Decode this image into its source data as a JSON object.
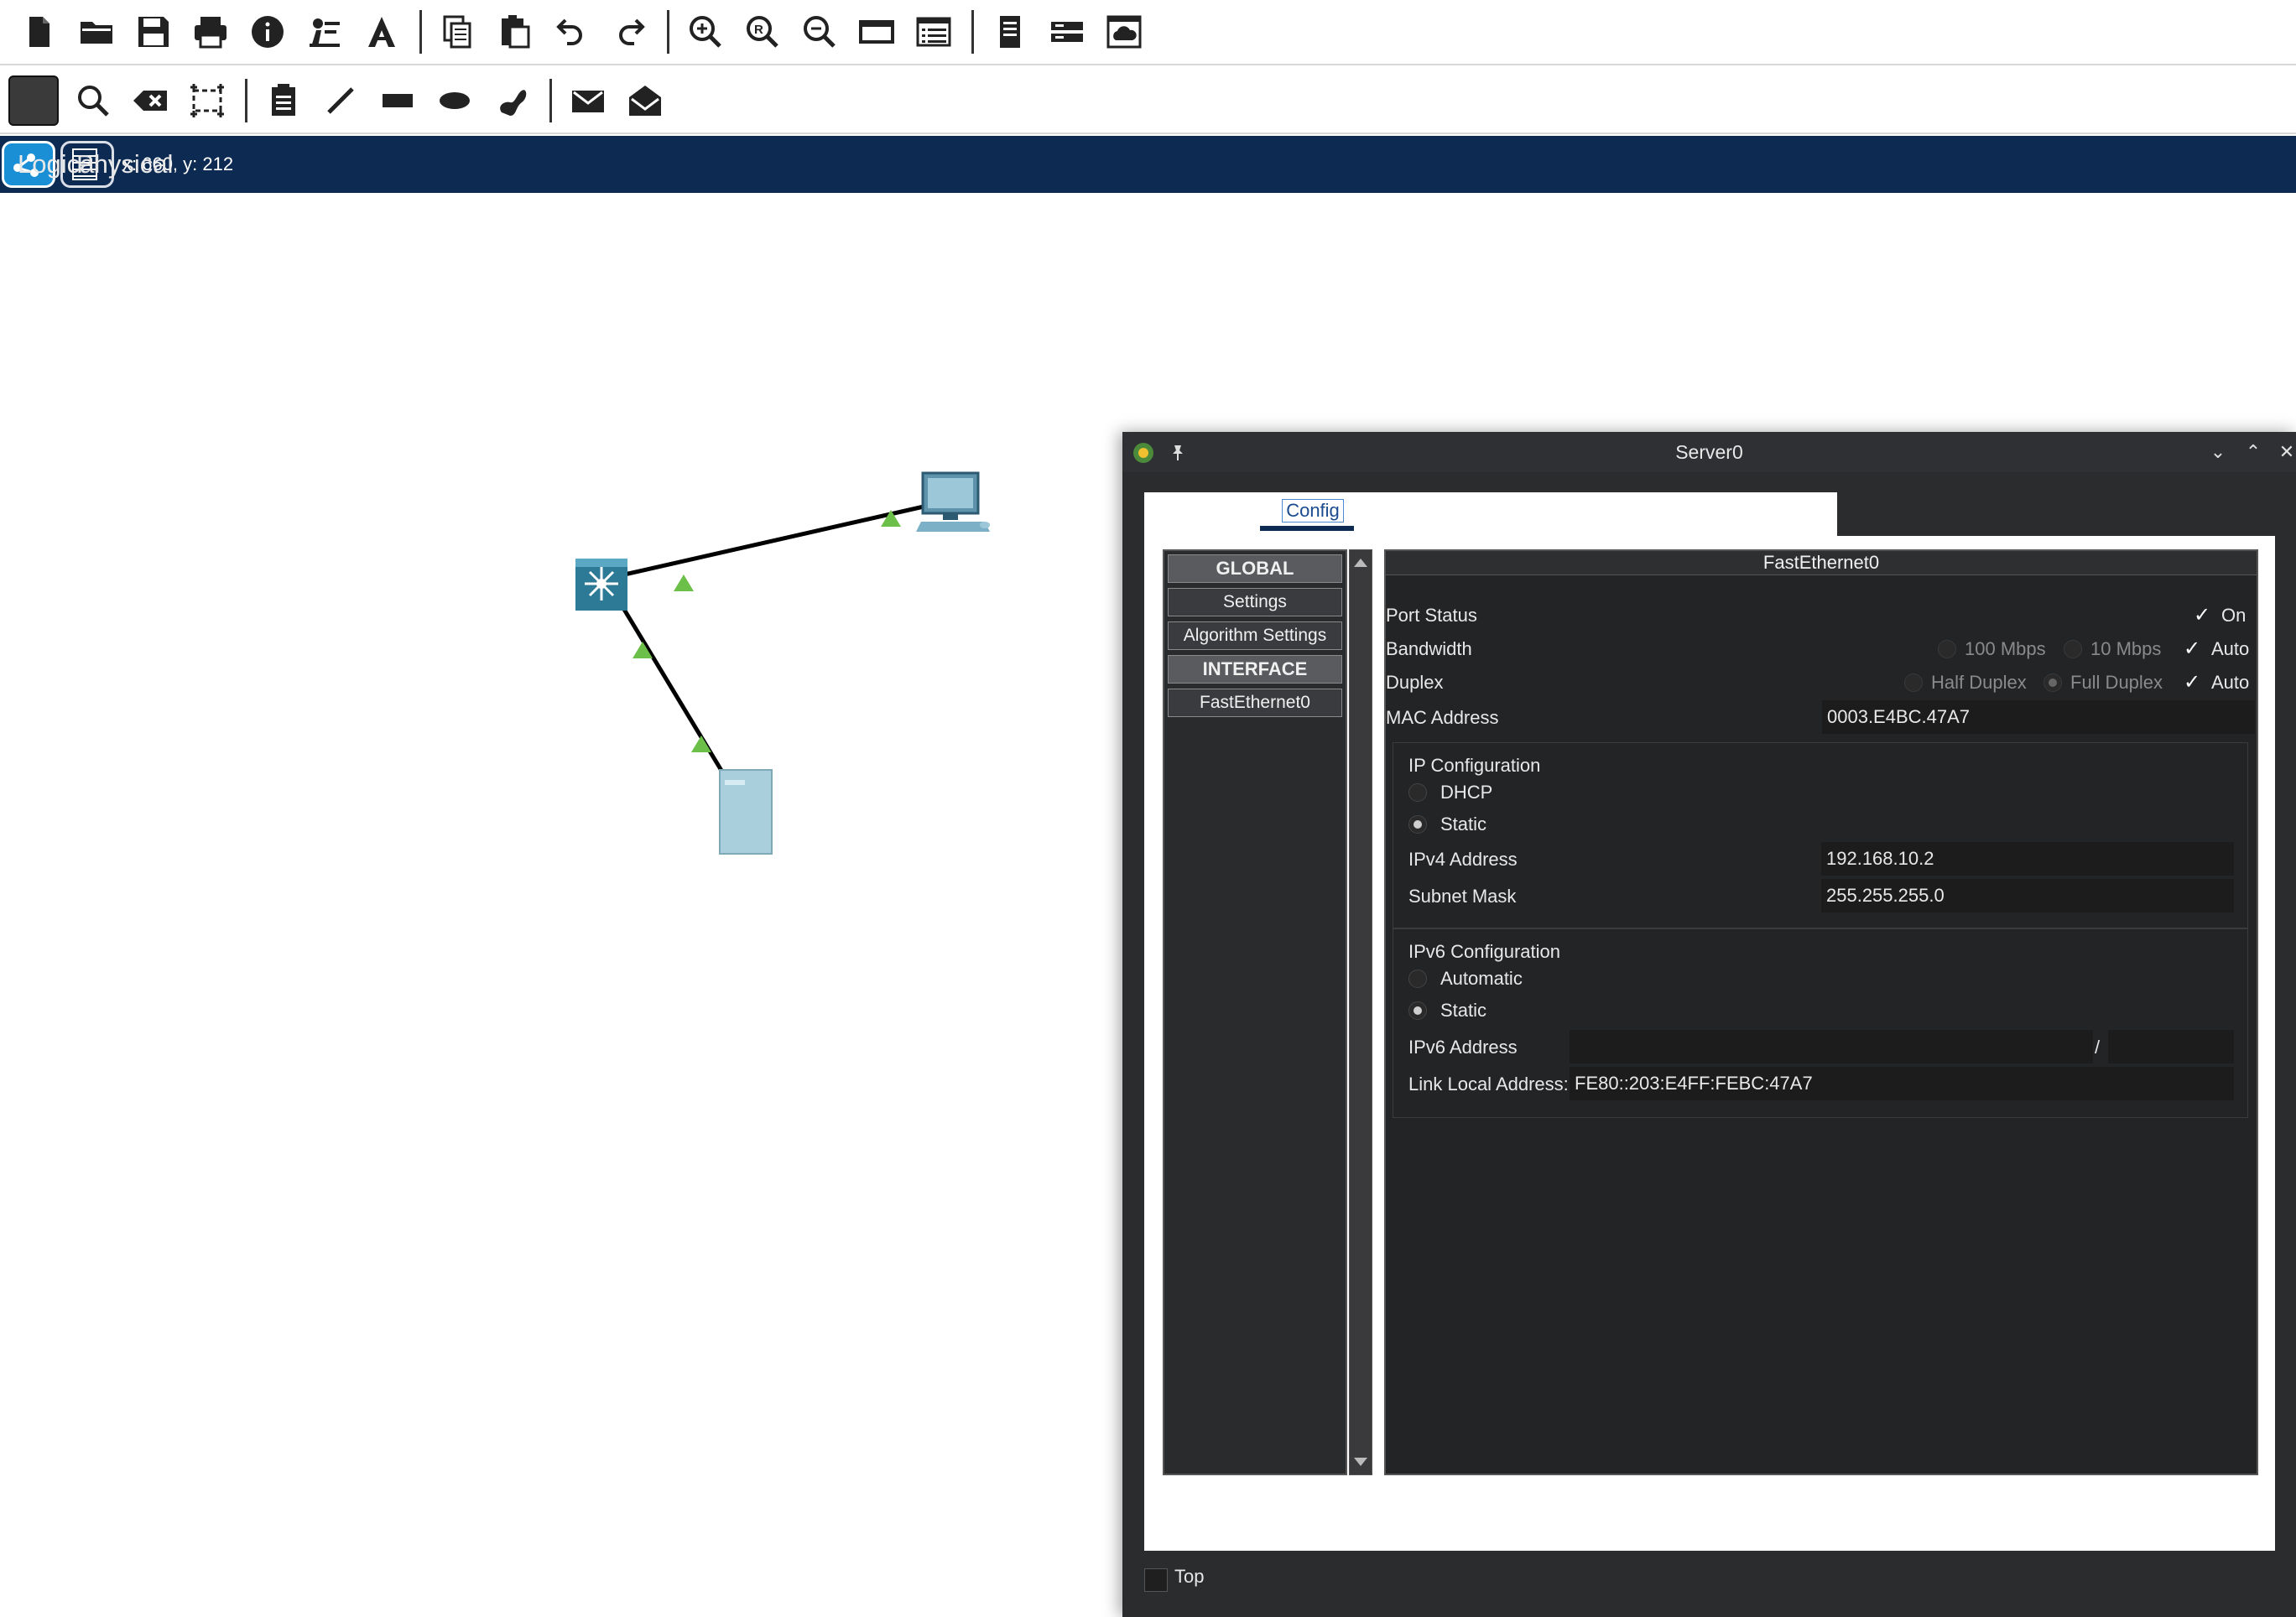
{
  "toolbar_main": [
    {
      "icon": "new-file-icon",
      "tooltip": "New"
    },
    {
      "icon": "open-folder-icon",
      "tooltip": "Open"
    },
    {
      "icon": "save-icon",
      "tooltip": "Save"
    },
    {
      "icon": "print-icon",
      "tooltip": "Print"
    },
    {
      "icon": "info-icon",
      "tooltip": "Activity Wizard"
    },
    {
      "icon": "network-info-icon",
      "tooltip": "Network Information"
    },
    {
      "icon": "custom-devices-icon",
      "tooltip": "Custom Devices"
    },
    {
      "icon": "copy-icon",
      "tooltip": "Copy"
    },
    {
      "icon": "paste-icon",
      "tooltip": "Paste"
    },
    {
      "icon": "undo-icon",
      "tooltip": "Undo"
    },
    {
      "icon": "redo-icon",
      "tooltip": "Redo"
    },
    {
      "icon": "zoom-in-icon",
      "tooltip": "Zoom In"
    },
    {
      "icon": "zoom-reset-icon",
      "tooltip": "Zoom Reset"
    },
    {
      "icon": "zoom-out-icon",
      "tooltip": "Zoom Out"
    },
    {
      "icon": "drawing-palette-icon",
      "tooltip": "Drawing Palette"
    },
    {
      "icon": "custom-device-dialog-icon",
      "tooltip": "Custom Device Dialog"
    },
    {
      "icon": "viewport-icon",
      "tooltip": "Viewport"
    },
    {
      "icon": "device-template-icon",
      "tooltip": "Device Template"
    },
    {
      "icon": "cloud-icon",
      "tooltip": "Cloud"
    }
  ],
  "mode": {
    "logical": "Logical",
    "physical": "Physical",
    "coords": "x: 660, y: 212"
  },
  "dialog": {
    "title": "Server0",
    "tab_config": "Config",
    "left_panel": {
      "global": "GLOBAL",
      "settings": "Settings",
      "algorithm": "Algorithm Settings",
      "interface": "INTERFACE",
      "fastethernet": "FastEthernet0"
    },
    "panel_title": "FastEthernet0",
    "port_status": "Port Status",
    "on": "On",
    "bandwidth": "Bandwidth",
    "bw_100": "100 Mbps",
    "bw_10": "10 Mbps",
    "auto": "Auto",
    "duplex": "Duplex",
    "half": "Half Duplex",
    "full": "Full Duplex",
    "mac_label": "MAC Address",
    "mac_value": "0003.E4BC.47A7",
    "ip_config": "IP Configuration",
    "dhcp": "DHCP",
    "static": "Static",
    "ipv4_label": "IPv4 Address",
    "ipv4_value": "192.168.10.2",
    "mask_label": "Subnet Mask",
    "mask_value": "255.255.255.0",
    "ipv6_config": "IPv6 Configuration",
    "automatic": "Automatic",
    "static6": "Static",
    "ipv6_label": "IPv6 Address",
    "ipv6_value": "",
    "ipv6_slash": "/",
    "linklocal_label": "Link Local Address:",
    "linklocal_value": "FE80::203:E4FF:FEBC:47A7",
    "top_label": "Top"
  },
  "colors": {
    "modebar": "#0c2a52",
    "logical_active": "#1a8fd6",
    "dialog_bg": "#2b2c2e",
    "link_up": "#6cc04a"
  }
}
